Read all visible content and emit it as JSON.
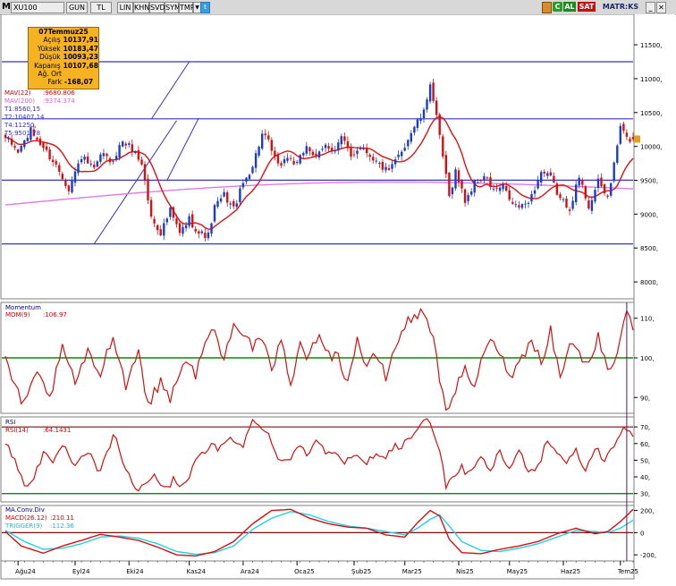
{
  "toolbar": {
    "symbol": "XU100",
    "buttons": [
      "GUN",
      "TL",
      "LIN",
      "KHN",
      "SVD",
      "SYM",
      "TMP"
    ],
    "al_label": "AL",
    "sat_label": "SAT",
    "matriks_label": "MATR:KS",
    "c_label": "C"
  },
  "info_box": {
    "date": "07Temmuz25",
    "rows": [
      {
        "label": "Açılış",
        "value": "10137,91"
      },
      {
        "label": "Yüksek",
        "value": "10183,47"
      },
      {
        "label": "Düşük",
        "value": "10093,23"
      },
      {
        "label": "Kapanış",
        "value": "10107,68"
      },
      {
        "label": "Ağ. Ort",
        "value": ""
      },
      {
        "label": "Fark",
        "value": "-168,07"
      }
    ]
  },
  "price_panel": {
    "labels": [
      "MAV(22)",
      "MAV(200)",
      "T1:8560,15",
      "T2:10407,14",
      "T4:11250,",
      "T5:9501,78"
    ],
    "mav22_value": ":9680.806",
    "mav200_value": ":9374.374",
    "label_colors": [
      "#d00000",
      "#e060e0",
      "#3030c0",
      "#3030c0",
      "#3030c0",
      "#3030c0"
    ]
  },
  "momentum_panel": {
    "title": "Momentum",
    "label": "MOM(9)",
    "value": ":106.97"
  },
  "rsi_panel": {
    "title": "RSI",
    "label": "RSI(14)",
    "value": ":64.1431"
  },
  "macd_panel": {
    "title": "MA.Conv.Div",
    "label": "MACD(26.12)",
    "value": ":210.11",
    "trigger_label": "TRIGGER(9)",
    "trigger_value": ":112.36"
  },
  "colors": {
    "up": "#1a3dc8",
    "down": "#d41010",
    "mav22": "#e01010",
    "mav200": "#e27ae2",
    "hline": "#3535c8",
    "green": "#0a8a0a",
    "cyan": "#22d0e8"
  },
  "chart_data": [
    {
      "type": "candlestick",
      "title": "XU100",
      "ylim": [
        7750,
        11950
      ],
      "yticks": [
        8000,
        8500,
        9000,
        9500,
        10000,
        10500,
        11000,
        11500
      ],
      "ytick_labels": [
        "8000,",
        "8500,",
        "9000,",
        "9500,",
        "10000,",
        "10500,",
        "11000,",
        "11500,"
      ],
      "x_months": [
        "Ağu24",
        "Eyl24",
        "Eki24",
        "Kas24",
        "Ara24",
        "Oca25",
        "Şub25",
        "Mar25",
        "Nis25",
        "May25",
        "Haz25",
        "Tem25"
      ],
      "horizontal_levels": [
        11250,
        10407.14,
        9501.78,
        8560.15
      ],
      "anchors": [
        [
          0,
          10130
        ],
        [
          4,
          9920
        ],
        [
          8,
          10230
        ],
        [
          12,
          9980
        ],
        [
          16,
          9720
        ],
        [
          20,
          9380
        ],
        [
          24,
          9850
        ],
        [
          28,
          9650
        ],
        [
          31,
          9920
        ],
        [
          33,
          9730
        ],
        [
          37,
          10080
        ],
        [
          40,
          9960
        ],
        [
          43,
          9750
        ],
        [
          46,
          8950
        ],
        [
          49,
          8730
        ],
        [
          52,
          9050
        ],
        [
          55,
          8710
        ],
        [
          58,
          8930
        ],
        [
          61,
          8720
        ],
        [
          64,
          8680
        ],
        [
          66,
          9100
        ],
        [
          69,
          9280
        ],
        [
          72,
          9080
        ],
        [
          75,
          9450
        ],
        [
          78,
          9720
        ],
        [
          81,
          10180
        ],
        [
          83,
          10050
        ],
        [
          86,
          9700
        ],
        [
          89,
          9850
        ],
        [
          92,
          9720
        ],
        [
          95,
          10020
        ],
        [
          98,
          9820
        ],
        [
          101,
          10010
        ],
        [
          104,
          9960
        ],
        [
          106,
          10130
        ],
        [
          109,
          9850
        ],
        [
          112,
          10010
        ],
        [
          115,
          9880
        ],
        [
          118,
          9720
        ],
        [
          121,
          9620
        ],
        [
          123,
          9780
        ],
        [
          126,
          10020
        ],
        [
          129,
          10300
        ],
        [
          132,
          10490
        ],
        [
          134,
          10950
        ],
        [
          136,
          10410
        ],
        [
          138,
          9850
        ],
        [
          140,
          9250
        ],
        [
          142,
          9640
        ],
        [
          145,
          9200
        ],
        [
          148,
          9450
        ],
        [
          151,
          9560
        ],
        [
          154,
          9350
        ],
        [
          157,
          9400
        ],
        [
          160,
          9140
        ],
        [
          163,
          9100
        ],
        [
          166,
          9270
        ],
        [
          169,
          9620
        ],
        [
          172,
          9530
        ],
        [
          175,
          9220
        ],
        [
          178,
          9100
        ],
        [
          181,
          9540
        ],
        [
          184,
          9120
        ],
        [
          187,
          9470
        ],
        [
          190,
          9250
        ],
        [
          192,
          9720
        ],
        [
          194,
          10300
        ],
        [
          196,
          10107.68
        ]
      ],
      "series": [
        {
          "name": "MAV(22)",
          "final_value": 9680.806
        },
        {
          "name": "MAV(200)",
          "final_value": 9374.374
        }
      ]
    },
    {
      "type": "line",
      "title": "Momentum",
      "ylim": [
        86,
        114
      ],
      "yticks": [
        90,
        100,
        110
      ],
      "reference_line": 100,
      "anchors": [
        [
          0,
          99
        ],
        [
          3,
          93
        ],
        [
          6,
          88
        ],
        [
          10,
          96
        ],
        [
          14,
          90
        ],
        [
          18,
          102
        ],
        [
          22,
          94
        ],
        [
          26,
          101
        ],
        [
          30,
          96
        ],
        [
          34,
          106
        ],
        [
          38,
          93
        ],
        [
          42,
          102
        ],
        [
          45,
          88
        ],
        [
          49,
          94
        ],
        [
          52,
          90
        ],
        [
          56,
          99
        ],
        [
          60,
          96
        ],
        [
          63,
          104
        ],
        [
          66,
          107
        ],
        [
          69,
          99
        ],
        [
          72,
          110
        ],
        [
          75,
          106
        ],
        [
          78,
          103
        ],
        [
          81,
          104
        ],
        [
          84,
          97
        ],
        [
          87,
          104
        ],
        [
          90,
          94
        ],
        [
          93,
          103
        ],
        [
          96,
          100
        ],
        [
          99,
          107
        ],
        [
          102,
          101
        ],
        [
          105,
          100
        ],
        [
          108,
          94
        ],
        [
          111,
          105
        ],
        [
          114,
          97
        ],
        [
          117,
          101
        ],
        [
          120,
          95
        ],
        [
          123,
          103
        ],
        [
          126,
          108
        ],
        [
          129,
          111
        ],
        [
          132,
          111
        ],
        [
          135,
          106
        ],
        [
          138,
          90
        ],
        [
          140,
          86
        ],
        [
          142,
          92
        ],
        [
          145,
          97
        ],
        [
          148,
          93
        ],
        [
          151,
          101
        ],
        [
          154,
          105
        ],
        [
          157,
          99
        ],
        [
          160,
          96
        ],
        [
          163,
          100
        ],
        [
          166,
          105
        ],
        [
          169,
          99
        ],
        [
          172,
          107
        ],
        [
          175,
          95
        ],
        [
          178,
          104
        ],
        [
          181,
          101
        ],
        [
          184,
          98
        ],
        [
          187,
          106
        ],
        [
          190,
          96
        ],
        [
          193,
          102
        ],
        [
          196,
          113
        ],
        [
          198,
          107
        ]
      ],
      "final_value": 106.97
    },
    {
      "type": "line",
      "title": "RSI",
      "ylim": [
        25,
        76
      ],
      "yticks": [
        30,
        40,
        50,
        60,
        70
      ],
      "reference_lines": [
        70,
        30
      ],
      "anchors": [
        [
          0,
          60
        ],
        [
          3,
          50
        ],
        [
          6,
          35
        ],
        [
          9,
          40
        ],
        [
          12,
          55
        ],
        [
          15,
          46
        ],
        [
          18,
          60
        ],
        [
          22,
          45
        ],
        [
          26,
          55
        ],
        [
          30,
          42
        ],
        [
          34,
          66
        ],
        [
          38,
          45
        ],
        [
          41,
          31
        ],
        [
          44,
          36
        ],
        [
          47,
          42
        ],
        [
          50,
          32
        ],
        [
          53,
          38
        ],
        [
          56,
          35
        ],
        [
          59,
          45
        ],
        [
          62,
          54
        ],
        [
          65,
          58
        ],
        [
          68,
          57
        ],
        [
          71,
          63
        ],
        [
          75,
          60
        ],
        [
          78,
          73
        ],
        [
          80,
          70
        ],
        [
          83,
          68
        ],
        [
          86,
          50
        ],
        [
          89,
          50
        ],
        [
          92,
          58
        ],
        [
          95,
          54
        ],
        [
          98,
          62
        ],
        [
          101,
          56
        ],
        [
          104,
          57
        ],
        [
          107,
          48
        ],
        [
          110,
          53
        ],
        [
          113,
          47
        ],
        [
          116,
          53
        ],
        [
          119,
          51
        ],
        [
          122,
          58
        ],
        [
          125,
          59
        ],
        [
          128,
          64
        ],
        [
          131,
          72
        ],
        [
          134,
          73
        ],
        [
          137,
          58
        ],
        [
          139,
          31
        ],
        [
          141,
          40
        ],
        [
          144,
          45
        ],
        [
          147,
          42
        ],
        [
          150,
          50
        ],
        [
          153,
          45
        ],
        [
          156,
          54
        ],
        [
          159,
          45
        ],
        [
          162,
          55
        ],
        [
          165,
          45
        ],
        [
          168,
          46
        ],
        [
          171,
          63
        ],
        [
          174,
          54
        ],
        [
          177,
          50
        ],
        [
          180,
          55
        ],
        [
          183,
          44
        ],
        [
          186,
          57
        ],
        [
          189,
          51
        ],
        [
          192,
          58
        ],
        [
          195,
          69
        ],
        [
          198,
          64.14
        ]
      ],
      "final_value": 64.1431
    },
    {
      "type": "line",
      "title": "MA.Conv.Div",
      "ylim": [
        -255,
        245
      ],
      "yticks": [
        200,
        0,
        -200
      ],
      "ytick_labels": [
        "200,",
        "0",
        "-200,"
      ],
      "reference_line": 0,
      "series": [
        {
          "name": "MACD(26.12)",
          "anchors": [
            [
              0,
              10
            ],
            [
              5,
              -120
            ],
            [
              12,
              -185
            ],
            [
              18,
              -120
            ],
            [
              24,
              -70
            ],
            [
              30,
              -15
            ],
            [
              36,
              -40
            ],
            [
              42,
              -70
            ],
            [
              48,
              -130
            ],
            [
              54,
              -200
            ],
            [
              60,
              -210
            ],
            [
              66,
              -170
            ],
            [
              72,
              -80
            ],
            [
              78,
              80
            ],
            [
              84,
              200
            ],
            [
              90,
              210
            ],
            [
              96,
              130
            ],
            [
              102,
              80
            ],
            [
              108,
              50
            ],
            [
              114,
              40
            ],
            [
              120,
              -20
            ],
            [
              126,
              -40
            ],
            [
              130,
              90
            ],
            [
              134,
              200
            ],
            [
              137,
              150
            ],
            [
              140,
              -60
            ],
            [
              144,
              -180
            ],
            [
              150,
              -190
            ],
            [
              156,
              -150
            ],
            [
              162,
              -120
            ],
            [
              168,
              -80
            ],
            [
              174,
              -10
            ],
            [
              180,
              40
            ],
            [
              186,
              -10
            ],
            [
              190,
              10
            ],
            [
              194,
              100
            ],
            [
              198,
              210.11
            ]
          ],
          "final_value": 210.11
        },
        {
          "name": "TRIGGER(9)",
          "anchors": [
            [
              0,
              20
            ],
            [
              6,
              -80
            ],
            [
              12,
              -150
            ],
            [
              18,
              -140
            ],
            [
              24,
              -100
            ],
            [
              30,
              -40
            ],
            [
              36,
              -30
            ],
            [
              42,
              -50
            ],
            [
              48,
              -100
            ],
            [
              54,
              -170
            ],
            [
              60,
              -195
            ],
            [
              66,
              -180
            ],
            [
              72,
              -120
            ],
            [
              78,
              30
            ],
            [
              84,
              130
            ],
            [
              90,
              190
            ],
            [
              96,
              160
            ],
            [
              102,
              100
            ],
            [
              108,
              60
            ],
            [
              114,
              40
            ],
            [
              120,
              10
            ],
            [
              126,
              -20
            ],
            [
              130,
              40
            ],
            [
              134,
              120
            ],
            [
              137,
              160
            ],
            [
              140,
              60
            ],
            [
              144,
              -80
            ],
            [
              150,
              -160
            ],
            [
              156,
              -170
            ],
            [
              162,
              -140
            ],
            [
              168,
              -100
            ],
            [
              174,
              -40
            ],
            [
              180,
              20
            ],
            [
              186,
              10
            ],
            [
              190,
              0
            ],
            [
              194,
              40
            ],
            [
              198,
              112.36
            ]
          ],
          "final_value": 112.36
        }
      ]
    }
  ]
}
